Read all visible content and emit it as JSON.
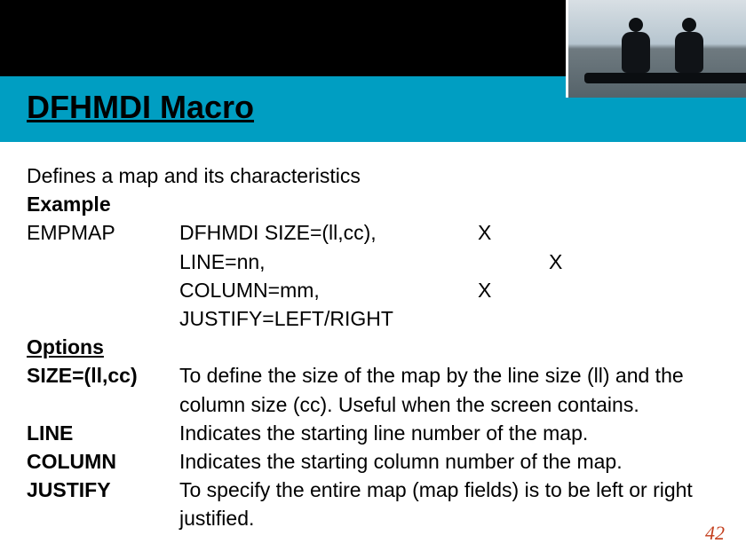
{
  "title": "DFHMDI  Macro",
  "intro": {
    "line1": "Defines a map and its characteristics",
    "example_label": "Example"
  },
  "macro": {
    "name": "EMPMAP",
    "rows": [
      {
        "code": "DFHMDI SIZE=(ll,cc),",
        "c1": "X",
        "c2": ""
      },
      {
        "code": "LINE=nn,",
        "c1": "",
        "c2": "X"
      },
      {
        "code": "COLUMN=mm,",
        "c1": "X",
        "c2": ""
      },
      {
        "code": "JUSTIFY=LEFT/RIGHT",
        "c1": "",
        "c2": ""
      }
    ]
  },
  "options_heading": "Options",
  "options": [
    {
      "name": "SIZE=(ll,cc)",
      "desc": "To define the size of the map by the line size (ll) and the column size (cc). Useful when the screen contains."
    },
    {
      "name": "LINE",
      "desc": "Indicates the starting line number of the map."
    },
    {
      "name": "COLUMN",
      "desc": "Indicates the starting column number of the map."
    },
    {
      "name": "JUSTIFY",
      "desc": "To specify the entire map (map fields) is to be left or right justified."
    }
  ],
  "page_number": "42"
}
